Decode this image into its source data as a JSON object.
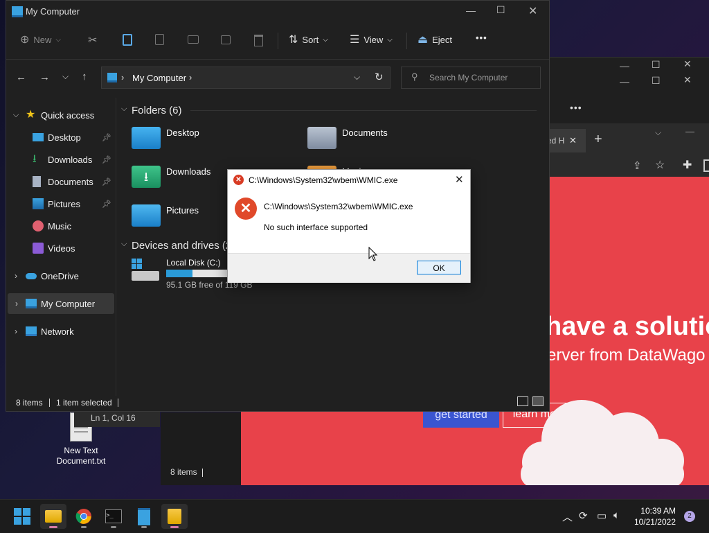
{
  "desktop": {
    "icon_label_line1": "New Text",
    "icon_label_line2": "Document.txt"
  },
  "notepad": {
    "status": "Ln 1, Col 16"
  },
  "explorer_back": {
    "status": "8 items"
  },
  "browser": {
    "tab_fragment": "ed H",
    "hero_title": "have a solutio",
    "hero_subtitle": "erver from DataWago",
    "get_started": "get started",
    "learn_more": "learn more"
  },
  "explorer": {
    "title": "My Computer",
    "toolbar": {
      "new": "New",
      "sort": "Sort",
      "view": "View",
      "eject": "Eject",
      "more": "•••"
    },
    "address": {
      "location": "My Computer",
      "search_placeholder": "Search My Computer"
    },
    "nav": {
      "quick_access": "Quick access",
      "items": [
        "Desktop",
        "Downloads",
        "Documents",
        "Pictures",
        "Music",
        "Videos"
      ],
      "onedrive": "OneDrive",
      "my_computer": "My Computer",
      "network": "Network"
    },
    "folders_header": "Folders (6)",
    "folders": [
      "Desktop",
      "Documents",
      "Downloads",
      "Music",
      "Pictures"
    ],
    "devices_header": "Devices and drives (2",
    "drive": {
      "name": "Local Disk (C:)",
      "free_text": "95.1 GB free of 119 GB",
      "used_fraction": 0.2
    },
    "status": {
      "items": "8 items",
      "selected": "1 item selected"
    }
  },
  "dialog": {
    "title": "C:\\Windows\\System32\\wbem\\WMIC.exe",
    "heading": "C:\\Windows\\System32\\wbem\\WMIC.exe",
    "message": "No such interface supported",
    "ok": "OK",
    "error_icon": "error-x-icon"
  },
  "taskbar": {
    "time": "10:39 AM",
    "date": "10/21/2022",
    "notification_count": "2"
  },
  "colors": {
    "accent": "#0078d7",
    "error": "#e0492a",
    "webpage_bg": "#e8424a",
    "drive_bar": "#2a9bd8"
  }
}
